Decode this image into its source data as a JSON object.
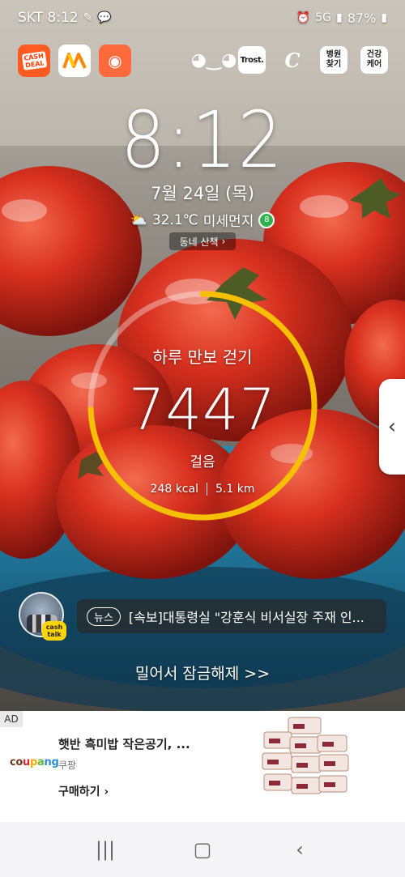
{
  "status_bar": {
    "carrier_time": "SKT 8:12",
    "network": "5G",
    "battery": "87%"
  },
  "shortcuts": {
    "cash_deal": [
      "CASH",
      "DEAL"
    ],
    "trost": "Trost.",
    "hospital": [
      "병원",
      "찾기"
    ],
    "health": [
      "건강",
      "케어"
    ]
  },
  "clock": {
    "time": "8:12",
    "date": "7월 24일 (목)"
  },
  "weather": {
    "temperature": "32.1℃",
    "dust_label": "미세먼지",
    "dust_badge": "8"
  },
  "walk_chip": {
    "label": "동네 산책",
    "chevron": "›"
  },
  "steps": {
    "title": "하루 만보 걷기",
    "count": "7447",
    "unit": "걸음",
    "kcal": "248 kcal",
    "distance": "5.1 km",
    "goal": 10000,
    "progress": 0.7447,
    "accent": "#f6c000"
  },
  "side_handle": {
    "chevron": "‹"
  },
  "news": {
    "badge_text": [
      "cash",
      "talk"
    ],
    "tag": "뉴스",
    "headline": "[속보]대통령실 \"강훈식 비서실장 주재 인..."
  },
  "unlock_hint": "밀어서 잠금해제 >>",
  "ad": {
    "label": "AD",
    "brand": [
      "co",
      "u",
      "p",
      "a",
      "ng"
    ],
    "title": "햇반 흑미밥 작은공기, ...",
    "seller": "쿠팡",
    "cta": "구매하기 ›"
  },
  "nav": {
    "recents": "|||",
    "home": "▢",
    "back": "‹"
  }
}
